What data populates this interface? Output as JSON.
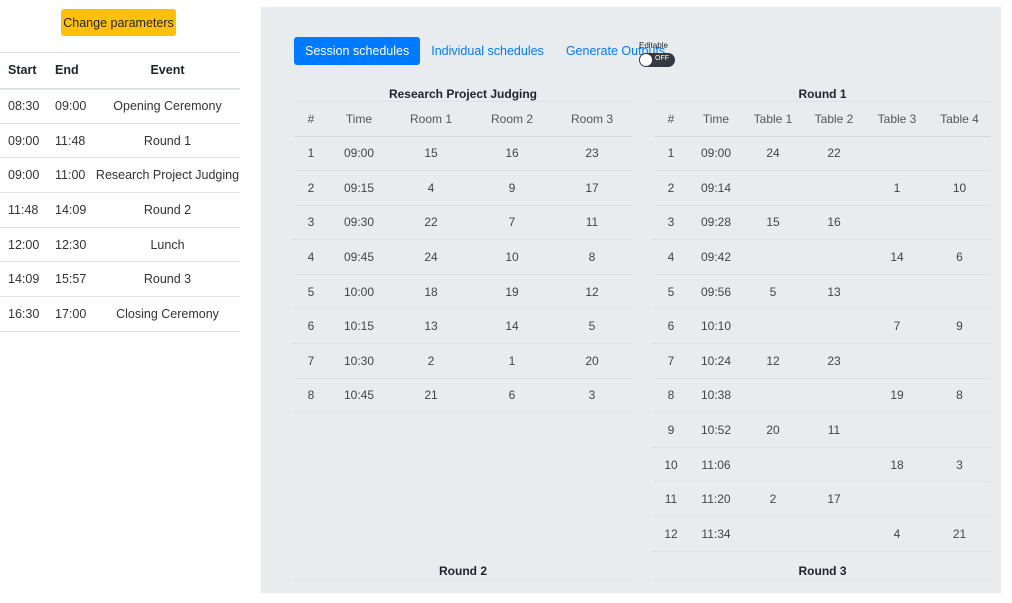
{
  "sidebar": {
    "change_button": "Change parameters",
    "headers": {
      "start": "Start",
      "end": "End",
      "event": "Event"
    },
    "events": [
      {
        "start": "08:30",
        "end": "09:00",
        "event": "Opening Ceremony"
      },
      {
        "start": "09:00",
        "end": "11:48",
        "event": "Round 1"
      },
      {
        "start": "09:00",
        "end": "11:00",
        "event": "Research Project Judging"
      },
      {
        "start": "11:48",
        "end": "14:09",
        "event": "Round 2"
      },
      {
        "start": "12:00",
        "end": "12:30",
        "event": "Lunch"
      },
      {
        "start": "14:09",
        "end": "15:57",
        "event": "Round 3"
      },
      {
        "start": "16:30",
        "end": "17:00",
        "event": "Closing Ceremony"
      }
    ]
  },
  "tabs": {
    "session": "Session schedules",
    "individual": "Individual schedules",
    "outputs": "Generate Outputs"
  },
  "editable": {
    "label": "Editable",
    "state": "OFF"
  },
  "judging": {
    "title": "Research Project Judging",
    "headers": [
      "#",
      "Time",
      "Room 1",
      "Room 2",
      "Room 3"
    ],
    "rows": [
      [
        "1",
        "09:00",
        "15",
        "16",
        "23"
      ],
      [
        "2",
        "09:15",
        "4",
        "9",
        "17"
      ],
      [
        "3",
        "09:30",
        "22",
        "7",
        "11"
      ],
      [
        "4",
        "09:45",
        "24",
        "10",
        "8"
      ],
      [
        "5",
        "10:00",
        "18",
        "19",
        "12"
      ],
      [
        "6",
        "10:15",
        "13",
        "14",
        "5"
      ],
      [
        "7",
        "10:30",
        "2",
        "1",
        "20"
      ],
      [
        "8",
        "10:45",
        "21",
        "6",
        "3"
      ]
    ]
  },
  "round1": {
    "title": "Round 1",
    "headers": [
      "#",
      "Time",
      "Table 1",
      "Table 2",
      "Table 3",
      "Table 4"
    ],
    "rows": [
      [
        "1",
        "09:00",
        "24",
        "22",
        "",
        ""
      ],
      [
        "2",
        "09:14",
        "",
        "",
        "1",
        "10"
      ],
      [
        "3",
        "09:28",
        "15",
        "16",
        "",
        ""
      ],
      [
        "4",
        "09:42",
        "",
        "",
        "14",
        "6"
      ],
      [
        "5",
        "09:56",
        "5",
        "13",
        "",
        ""
      ],
      [
        "6",
        "10:10",
        "",
        "",
        "7",
        "9"
      ],
      [
        "7",
        "10:24",
        "12",
        "23",
        "",
        ""
      ],
      [
        "8",
        "10:38",
        "",
        "",
        "19",
        "8"
      ],
      [
        "9",
        "10:52",
        "20",
        "11",
        "",
        ""
      ],
      [
        "10",
        "11:06",
        "",
        "",
        "18",
        "3"
      ],
      [
        "11",
        "11:20",
        "2",
        "17",
        "",
        ""
      ],
      [
        "12",
        "11:34",
        "",
        "",
        "4",
        "21"
      ]
    ]
  },
  "round2": {
    "title": "Round 2"
  },
  "round3": {
    "title": "Round 3"
  }
}
